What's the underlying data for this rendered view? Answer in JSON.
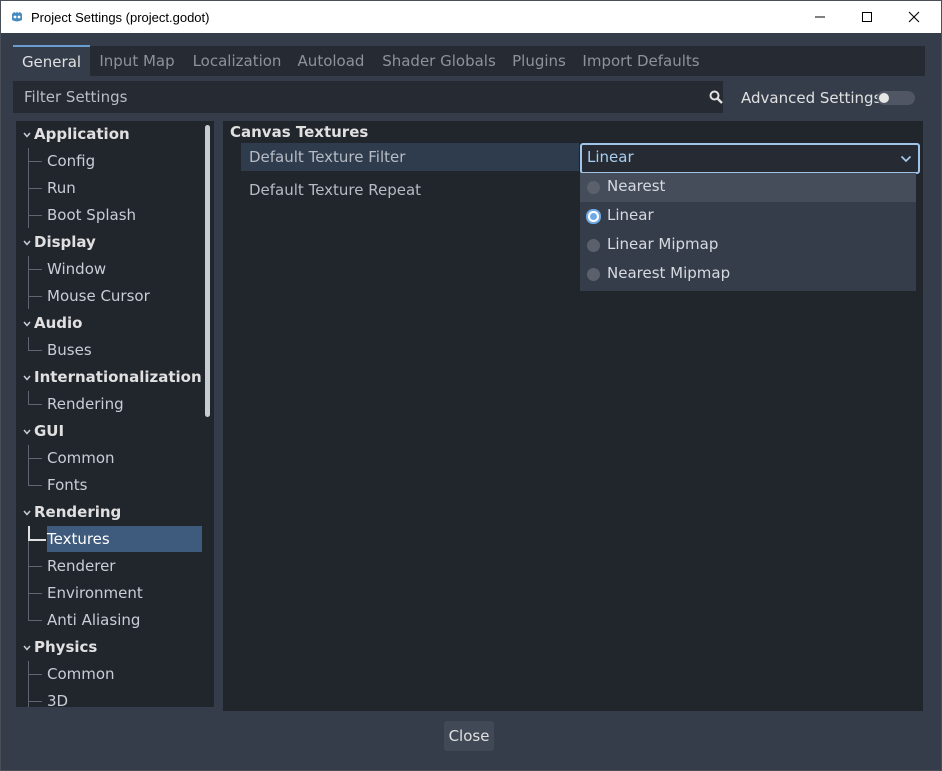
{
  "window": {
    "title": "Project Settings (project.godot)",
    "minimize_icon": "minimize-icon",
    "maximize_icon": "maximize-icon",
    "close_icon": "close-icon"
  },
  "tabs": [
    {
      "label": "General",
      "active": true
    },
    {
      "label": "Input Map",
      "active": false
    },
    {
      "label": "Localization",
      "active": false
    },
    {
      "label": "Autoload",
      "active": false
    },
    {
      "label": "Shader Globals",
      "active": false
    },
    {
      "label": "Plugins",
      "active": false
    },
    {
      "label": "Import Defaults",
      "active": false
    }
  ],
  "filter": {
    "placeholder": "Filter Settings",
    "icon": "search-icon"
  },
  "advanced": {
    "label": "Advanced Settings",
    "enabled": false
  },
  "tree": {
    "categories": [
      {
        "label": "Application",
        "items": [
          "Config",
          "Run",
          "Boot Splash"
        ]
      },
      {
        "label": "Display",
        "items": [
          "Window",
          "Mouse Cursor"
        ]
      },
      {
        "label": "Audio",
        "items": [
          "Buses"
        ]
      },
      {
        "label": "Internationalization",
        "items": [
          "Rendering"
        ]
      },
      {
        "label": "GUI",
        "items": [
          "Common",
          "Fonts"
        ]
      },
      {
        "label": "Rendering",
        "items": [
          "Textures",
          "Renderer",
          "Environment",
          "Anti Aliasing"
        ]
      },
      {
        "label": "Physics",
        "items": [
          "Common",
          "3D"
        ]
      }
    ],
    "selected": "Textures"
  },
  "content": {
    "section": "Canvas Textures",
    "properties": [
      {
        "label": "Default Texture Filter",
        "value": "Linear"
      },
      {
        "label": "Default Texture Repeat"
      }
    ],
    "dropdown_options": [
      {
        "label": "Nearest",
        "checked": false,
        "hover": true
      },
      {
        "label": "Linear",
        "checked": true,
        "hover": false
      },
      {
        "label": "Linear Mipmap",
        "checked": false,
        "hover": false
      },
      {
        "label": "Nearest Mipmap",
        "checked": false,
        "hover": false
      }
    ]
  },
  "footer": {
    "close_label": "Close"
  },
  "colors": {
    "accent": "#6a9ed1",
    "selection": "#3e5a7c",
    "panel": "#21252c",
    "background": "#363d4a"
  }
}
